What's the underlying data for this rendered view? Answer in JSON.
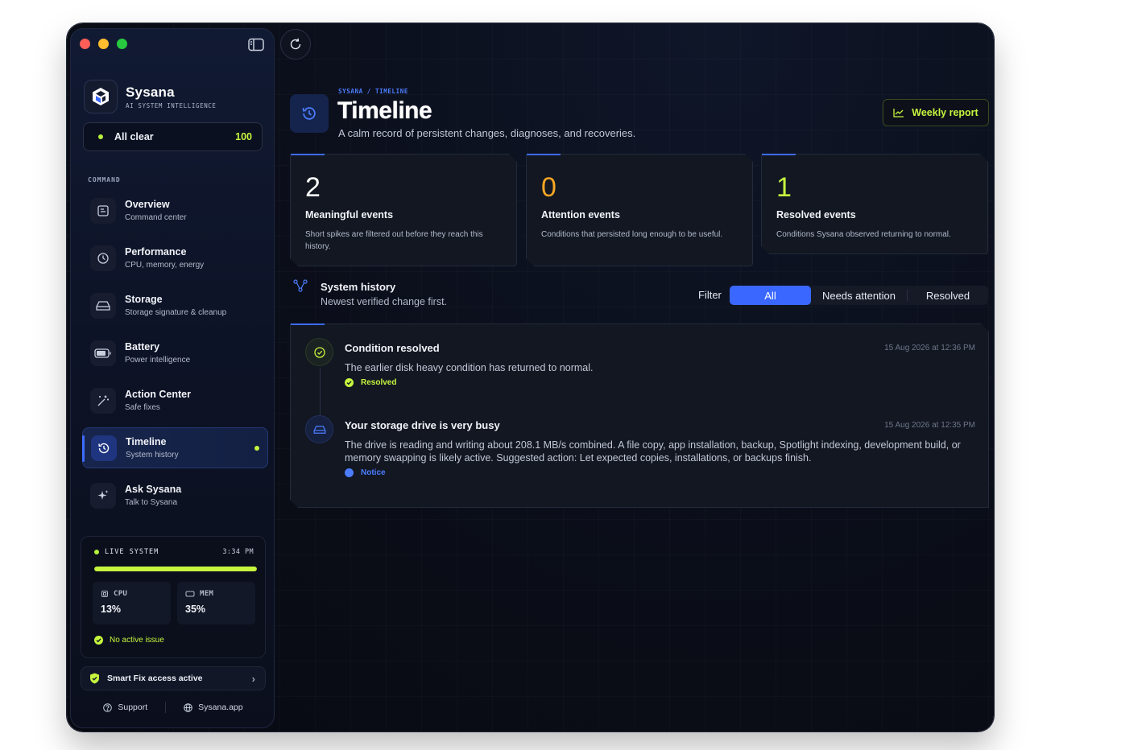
{
  "app": {
    "name": "Sysana",
    "tagline": "AI SYSTEM INTELLIGENCE"
  },
  "status": {
    "label": "All clear",
    "score": "100"
  },
  "sidebar": {
    "section": "COMMAND",
    "items": [
      {
        "title": "Overview",
        "sub": "Command center",
        "icon": "overview-icon"
      },
      {
        "title": "Performance",
        "sub": "CPU, memory, energy",
        "icon": "gauge-icon"
      },
      {
        "title": "Storage",
        "sub": "Storage signature & cleanup",
        "icon": "drive-icon"
      },
      {
        "title": "Battery",
        "sub": "Power intelligence",
        "icon": "battery-icon"
      },
      {
        "title": "Action Center",
        "sub": "Safe fixes",
        "icon": "wand-icon"
      },
      {
        "title": "Timeline",
        "sub": "System history",
        "icon": "history-icon",
        "active": true
      },
      {
        "title": "Ask Sysana",
        "sub": "Talk to Sysana",
        "icon": "sparkle-icon"
      }
    ]
  },
  "live": {
    "label": "LIVE SYSTEM",
    "time": "3:34 PM",
    "bar_fill": 1.0,
    "cpu_label": "CPU",
    "cpu_value": "13%",
    "mem_label": "MEM",
    "mem_value": "35%",
    "issue": "No active issue"
  },
  "smartfix": {
    "label": "Smart Fix access active"
  },
  "footer": {
    "support": "Support",
    "site": "Sysana.app"
  },
  "page": {
    "breadcrumb": "SYSANA / TIMELINE",
    "title": "Timeline",
    "subtitle": "A calm record of persistent changes, diagnoses, and recoveries.",
    "report_button": "Weekly report"
  },
  "stats": [
    {
      "value": "2",
      "title": "Meaningful events",
      "desc": "Short spikes are filtered out before they reach this history.",
      "color": "#ffffff"
    },
    {
      "value": "0",
      "title": "Attention events",
      "desc": "Conditions that persisted long enough to be useful.",
      "color": "#f5a623"
    },
    {
      "value": "1",
      "title": "Resolved events",
      "desc": "Conditions Sysana observed returning to normal.",
      "color": "#c6f53e"
    }
  ],
  "history": {
    "title": "System history",
    "subtitle": "Newest verified change first.",
    "filter_label": "Filter",
    "filters": [
      "All",
      "Needs attention",
      "Resolved"
    ],
    "active_filter": "All"
  },
  "events": [
    {
      "title": "Condition resolved",
      "time": "15 Aug 2026 at 12:36 PM",
      "body": "The earlier disk heavy condition has returned to normal.",
      "tag": "Resolved",
      "tag_color": "#c6f53e"
    },
    {
      "title": "Your storage drive is very busy",
      "time": "15 Aug 2026 at 12:35 PM",
      "body": "The drive is reading and writing about 208.1 MB/s combined. A file copy, app installation, backup, Spotlight indexing, development build, or memory swapping is likely active. Suggested action: Let expected copies, installations, or backups finish.",
      "tag": "Notice",
      "tag_color": "#4c7dff"
    }
  ],
  "colors": {
    "accent": "#3a67ff",
    "lime": "#c6f53e",
    "amber": "#f5a623"
  }
}
